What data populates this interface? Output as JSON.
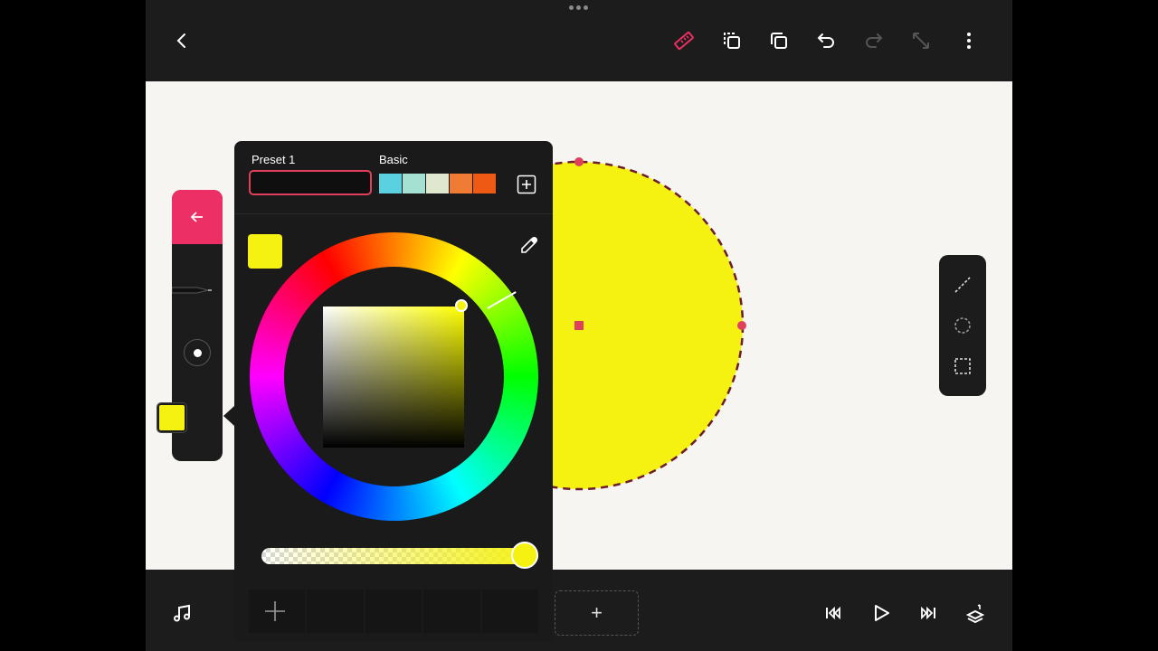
{
  "topbar": {
    "icons": [
      "back-chevron-icon",
      "ruler-icon",
      "copy-icon",
      "duplicate-icon",
      "undo-icon",
      "redo-icon",
      "resize-icon",
      "more-icon"
    ],
    "accent": "#ec2f64"
  },
  "canvas": {
    "background": "#f6f5f1",
    "shape": {
      "type": "circle",
      "fill": "#f5f211",
      "outline": "dashed",
      "handle_color": "#e0405b"
    }
  },
  "tool_panel": {
    "active_color": "#f5f211"
  },
  "color_picker": {
    "preset_label": "Preset 1",
    "basic_label": "Basic",
    "basic_swatches": [
      "#5bd0df",
      "#a5e1d3",
      "#dfe8cf",
      "#ef7b34",
      "#ee5a14"
    ],
    "current_color": "#f5f211",
    "opacity": 1.0
  },
  "bottombar": {
    "add_frame_label": "+",
    "icons": [
      "music-icon",
      "skip-back-icon",
      "play-icon",
      "skip-forward-icon",
      "layers-icon"
    ]
  }
}
